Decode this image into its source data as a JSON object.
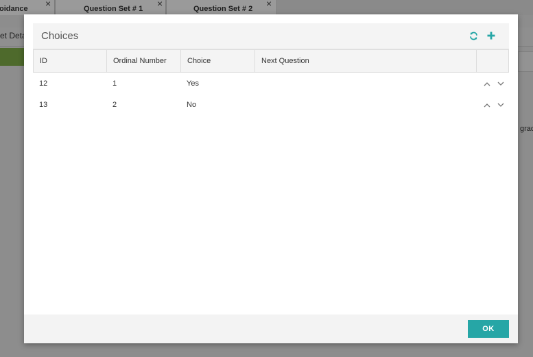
{
  "background": {
    "tabs": [
      {
        "label": "oidance"
      },
      {
        "label": "Question Set # 1"
      },
      {
        "label": "Question Set # 2"
      }
    ],
    "subnav_label": "et Deta",
    "right_label": "grad"
  },
  "modal": {
    "title": "Choices",
    "columns": [
      "ID",
      "Ordinal Number",
      "Choice",
      "Next Question"
    ],
    "rows": [
      {
        "id": "12",
        "ordinal": "1",
        "choice": "Yes",
        "next_question": ""
      },
      {
        "id": "13",
        "ordinal": "2",
        "choice": "No",
        "next_question": ""
      }
    ],
    "ok_label": "OK"
  },
  "colors": {
    "accent": "#26a6a6",
    "green_bar": "#4e6a2c"
  },
  "icons": {
    "refresh": "refresh-icon",
    "add": "plus-icon",
    "up": "chevron-up-icon",
    "down": "chevron-down-icon",
    "close": "close-icon"
  }
}
